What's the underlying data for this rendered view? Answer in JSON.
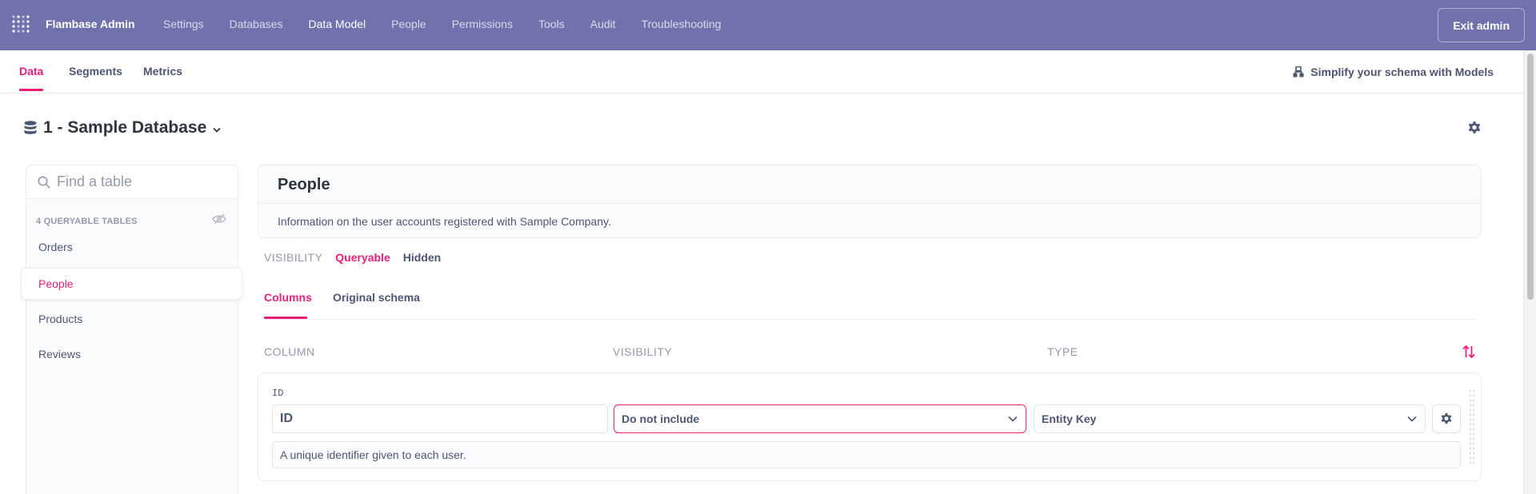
{
  "topnav": {
    "brand": "Flambase Admin",
    "links": [
      "Settings",
      "Databases",
      "Data Model",
      "People",
      "Permissions",
      "Tools",
      "Audit",
      "Troubleshooting"
    ],
    "active_link": "Data Model",
    "exit_label": "Exit admin",
    "bg_color": "#7172ad"
  },
  "subnav": {
    "tabs": [
      "Data",
      "Segments",
      "Metrics"
    ],
    "active_tab": "Data",
    "simplify_label": "Simplify your schema with Models"
  },
  "database": {
    "title": "1 - Sample Database"
  },
  "sidebar": {
    "search_placeholder": "Find a table",
    "tables_header": "4 QUERYABLE TABLES",
    "tables": [
      "Orders",
      "People",
      "Products",
      "Reviews"
    ],
    "active_table": "People"
  },
  "table": {
    "name": "People",
    "description": "Information on the user accounts registered with Sample Company.",
    "visibility_label": "VISIBILITY",
    "visibility_options": [
      "Queryable",
      "Hidden"
    ],
    "visibility_selected": "Queryable",
    "column_tabs": [
      "Columns",
      "Original schema"
    ],
    "active_column_tab": "Columns",
    "column_headers": {
      "column": "COLUMN",
      "visibility": "VISIBILITY",
      "type": "TYPE"
    }
  },
  "fields": [
    {
      "key": "ID",
      "display_name": "ID",
      "visibility": "Do not include",
      "semantic_type": "Entity Key",
      "description": "A unique identifier given to each user."
    }
  ],
  "colors": {
    "accent": "#ed1e79",
    "text": "#4c5773",
    "muted": "#949aab"
  }
}
